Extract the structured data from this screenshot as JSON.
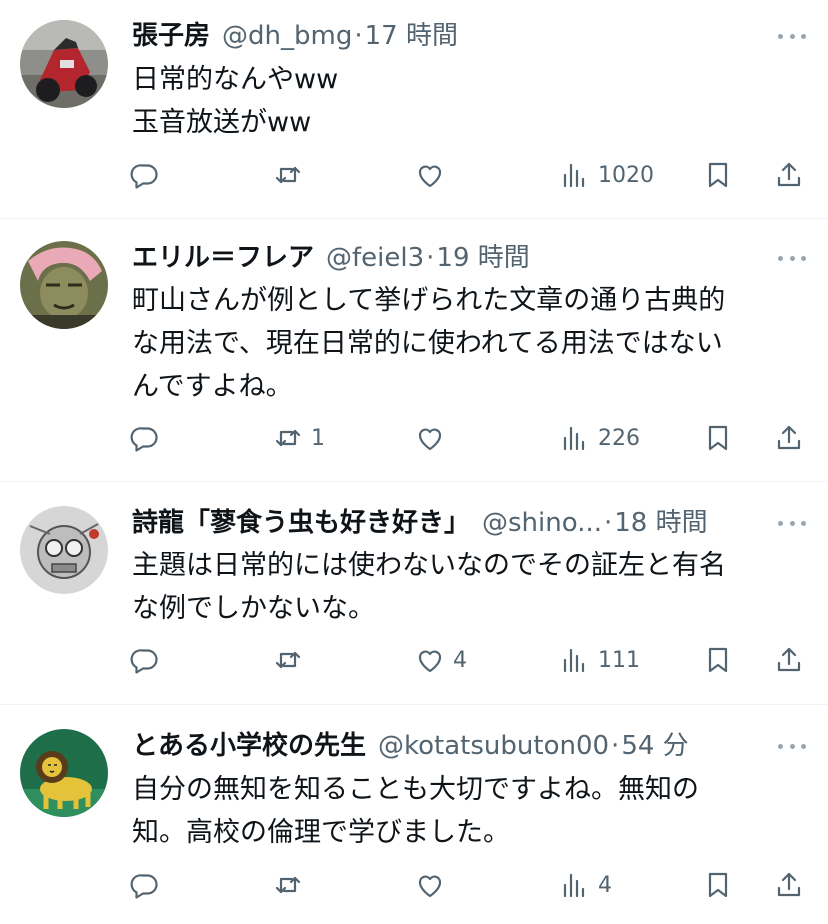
{
  "posts": [
    {
      "name": "張子房",
      "handle": "@dh_bmg",
      "separator": "·",
      "time": "17 時間",
      "lines": [
        "日常的なんやww",
        "玉音放送がww"
      ],
      "reply_count": "",
      "retweet_count": "",
      "like_count": "",
      "view_count": "1020",
      "avatar": "motorcycle-photo"
    },
    {
      "name": "エリル＝フレア",
      "handle": "@feiel3",
      "separator": "·",
      "time": "19 時間",
      "lines": [
        "町山さんが例として挙げられた文章の通り古典的",
        "な用法で、現在日常的に使われてる用法ではない",
        "んですよね。"
      ],
      "reply_count": "",
      "retweet_count": "1",
      "like_count": "",
      "view_count": "226",
      "avatar": "illustrated-character"
    },
    {
      "name": "詩龍「蓼食う虫も好き好き」",
      "handle": "@shino...",
      "separator": "·",
      "time": "18 時間",
      "lines": [
        "主題は日常的には使わないなのでその証左と有名",
        "な例でしかないな。"
      ],
      "reply_count": "",
      "retweet_count": "",
      "like_count": "4",
      "view_count": "111",
      "avatar": "robot-sketch"
    },
    {
      "name": "とある小学校の先生",
      "handle": "@kotatsubuton00",
      "separator": "·",
      "time": "54 分",
      "lines": [
        "自分の無知を知ることも大切ですよね。無知の",
        "知。高校の倫理で学びました。"
      ],
      "reply_count": "",
      "retweet_count": "",
      "like_count": "",
      "view_count": "4",
      "avatar": "lion-illustration"
    }
  ],
  "icons": {
    "reply": "speech-bubble-icon",
    "retweet": "repost-arrows-icon",
    "like": "heart-icon",
    "views": "bar-chart-icon",
    "bookmark": "bookmark-icon",
    "share": "upload-arrow-icon",
    "more": "ellipsis-icon"
  },
  "colors": {
    "text": "#0f1419",
    "secondary": "#536471",
    "divider": "#eff3f4"
  }
}
